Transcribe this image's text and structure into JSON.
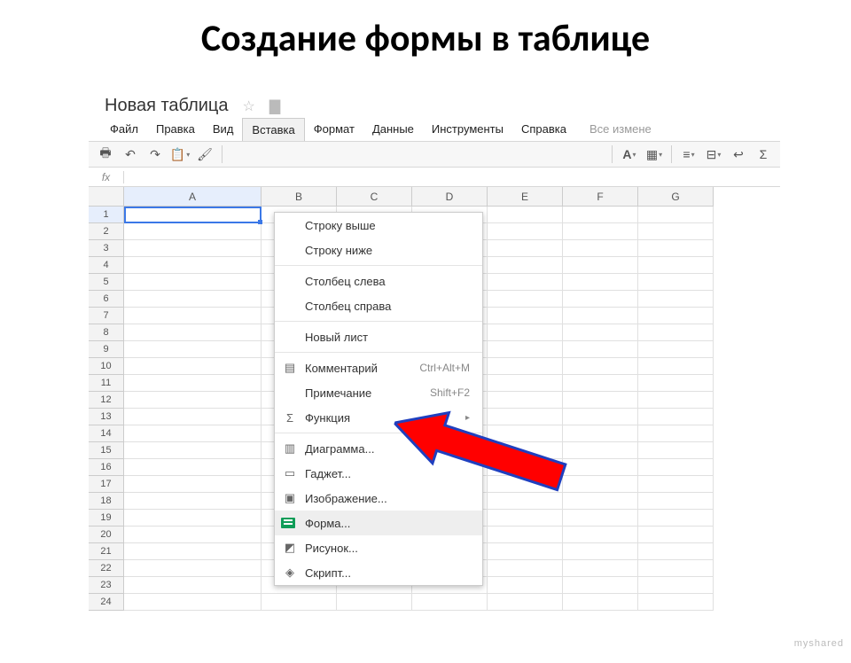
{
  "slide": {
    "title": "Создание формы в таблице"
  },
  "doc": {
    "title": "Новая таблица"
  },
  "menubar": {
    "file": "Файл",
    "edit": "Правка",
    "view": "Вид",
    "insert": "Вставка",
    "format": "Формат",
    "data": "Данные",
    "tools": "Инструменты",
    "help": "Справка",
    "extra": "Все измене"
  },
  "fx": {
    "label": "fx"
  },
  "columns": [
    "A",
    "B",
    "C",
    "D",
    "E",
    "F",
    "G"
  ],
  "row_count": 24,
  "dropdown": {
    "row_above": "Строку выше",
    "row_below": "Строку ниже",
    "col_left": "Столбец слева",
    "col_right": "Столбец справа",
    "new_sheet": "Новый лист",
    "comment": "Комментарий",
    "comment_sc": "Ctrl+Alt+M",
    "note": "Примечание",
    "note_sc": "Shift+F2",
    "function": "Функция",
    "chart": "Диаграмма...",
    "gadget": "Гаджет...",
    "image": "Изображение...",
    "form": "Форма...",
    "drawing": "Рисунок...",
    "script": "Скрипт..."
  },
  "watermark": "myshared"
}
